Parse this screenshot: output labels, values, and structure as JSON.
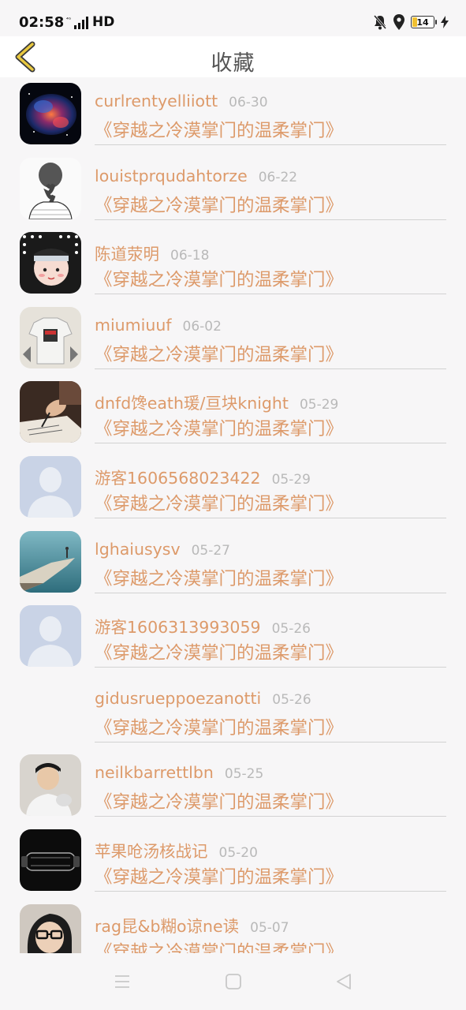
{
  "status_bar": {
    "time": "02:58",
    "network": "HD",
    "battery": "14"
  },
  "header": {
    "title": "收藏"
  },
  "favorites": [
    {
      "username": "curlrentyelliiott",
      "date": "06-30",
      "book": "《穿越之冷漠掌门的温柔掌门》",
      "avatar": "galaxy-avatar"
    },
    {
      "username": "louistprqudahtorze",
      "date": "06-22",
      "book": "《穿越之冷漠掌门的温柔掌门》",
      "avatar": "braid-sketch-avatar"
    },
    {
      "username": "陈道荥明",
      "date": "06-18",
      "book": "《穿越之冷漠掌门的温柔掌门》",
      "avatar": "anime-avatar"
    },
    {
      "username": "miumiuuf",
      "date": "06-02",
      "book": "《穿越之冷漠掌门的温柔掌门》",
      "avatar": "tshirt-avatar"
    },
    {
      "username": "dnfd馋eath瑗/亘块knight",
      "date": "05-29",
      "book": "《穿越之冷漠掌门的温柔掌门》",
      "avatar": "writing-hand-avatar"
    },
    {
      "username": "游客1606568023422",
      "date": "05-29",
      "book": "《穿越之冷漠掌门的温柔掌门》",
      "avatar": "default-avatar"
    },
    {
      "username": "lghaiusysv",
      "date": "05-27",
      "book": "《穿越之冷漠掌门的温柔掌门》",
      "avatar": "cliff-avatar"
    },
    {
      "username": "游客1606313993059",
      "date": "05-26",
      "book": "《穿越之冷漠掌门的温柔掌门》",
      "avatar": "default-avatar"
    },
    {
      "username": "gidusrueppoezanotti",
      "date": "05-26",
      "book": "《穿越之冷漠掌门的温柔掌门》",
      "avatar": "none"
    },
    {
      "username": "neilkbarrettlbn",
      "date": "05-25",
      "book": "《穿越之冷漠掌门的温柔掌门》",
      "avatar": "person-photo-avatar"
    },
    {
      "username": "苹果呛汤核战记",
      "date": "05-20",
      "book": "《穿越之冷漠掌门的温柔掌门》",
      "avatar": "car-avatar"
    },
    {
      "username": "rag昆&b糊o谅ne读",
      "date": "05-07",
      "book": "《穿越之冷漠掌门的温柔掌门》",
      "avatar": "glasses-girl-avatar"
    }
  ],
  "colors": {
    "accent": "#dd9a6a",
    "date": "#b9b9b9",
    "back_arrow": "#e8c840"
  }
}
